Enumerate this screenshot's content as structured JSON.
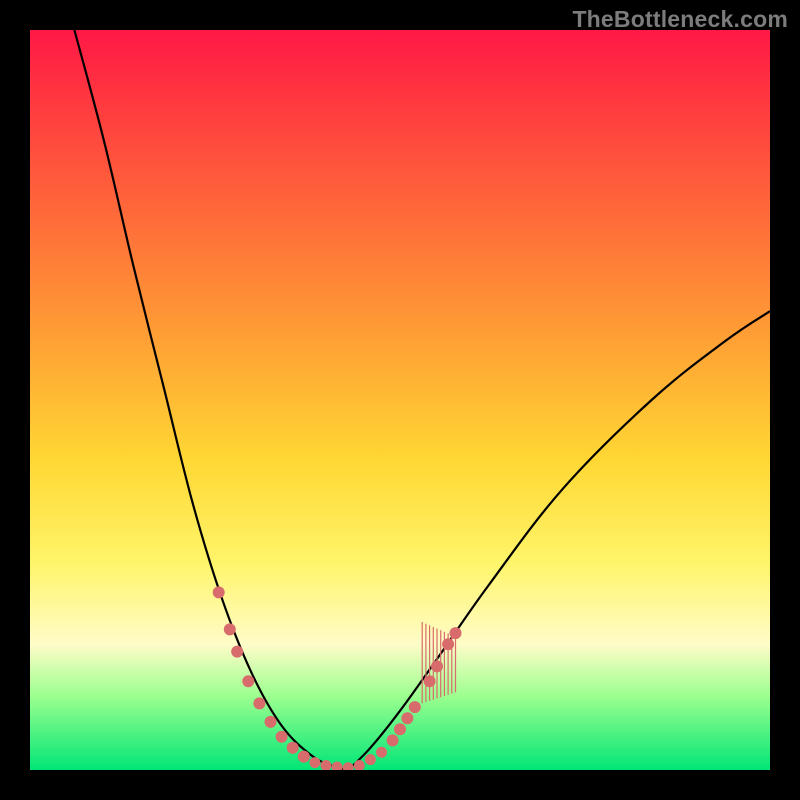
{
  "watermark": "TheBottleneck.com",
  "chart_data": {
    "type": "line",
    "title": "",
    "xlabel": "",
    "ylabel": "",
    "xlim": [
      0,
      100
    ],
    "ylim": [
      0,
      100
    ],
    "left_curve": [
      {
        "x": 6,
        "y": 100
      },
      {
        "x": 10,
        "y": 85
      },
      {
        "x": 14,
        "y": 68
      },
      {
        "x": 18,
        "y": 52
      },
      {
        "x": 22,
        "y": 36
      },
      {
        "x": 26,
        "y": 23
      },
      {
        "x": 30,
        "y": 13
      },
      {
        "x": 34,
        "y": 6
      },
      {
        "x": 38,
        "y": 2
      },
      {
        "x": 41,
        "y": 0.5
      },
      {
        "x": 43,
        "y": 0
      }
    ],
    "right_curve": [
      {
        "x": 43,
        "y": 0
      },
      {
        "x": 46,
        "y": 3
      },
      {
        "x": 50,
        "y": 8
      },
      {
        "x": 55,
        "y": 15
      },
      {
        "x": 62,
        "y": 25
      },
      {
        "x": 72,
        "y": 38
      },
      {
        "x": 84,
        "y": 50
      },
      {
        "x": 94,
        "y": 58
      },
      {
        "x": 100,
        "y": 62
      }
    ],
    "dots_left": [
      {
        "x": 25.5,
        "y": 24
      },
      {
        "x": 27,
        "y": 19
      },
      {
        "x": 28,
        "y": 16
      },
      {
        "x": 29.5,
        "y": 12
      },
      {
        "x": 31,
        "y": 9
      },
      {
        "x": 32.5,
        "y": 6.5
      },
      {
        "x": 34,
        "y": 4.5
      },
      {
        "x": 35.5,
        "y": 3
      },
      {
        "x": 37,
        "y": 1.8
      }
    ],
    "dots_bottom": [
      {
        "x": 38.5,
        "y": 1
      },
      {
        "x": 40,
        "y": 0.6
      },
      {
        "x": 41.5,
        "y": 0.4
      },
      {
        "x": 43,
        "y": 0.3
      },
      {
        "x": 44.5,
        "y": 0.6
      },
      {
        "x": 46,
        "y": 1.4
      },
      {
        "x": 47.5,
        "y": 2.4
      }
    ],
    "dots_right": [
      {
        "x": 49,
        "y": 4
      },
      {
        "x": 50,
        "y": 5.5
      },
      {
        "x": 51,
        "y": 7
      },
      {
        "x": 52,
        "y": 8.5
      },
      {
        "x": 54,
        "y": 12
      },
      {
        "x": 55,
        "y": 14
      },
      {
        "x": 56.5,
        "y": 17
      },
      {
        "x": 57.5,
        "y": 18.5
      }
    ],
    "hatch_patch": {
      "x0": 53,
      "x1": 57.5,
      "y0": 9,
      "y1": 20,
      "lines": 10
    }
  }
}
